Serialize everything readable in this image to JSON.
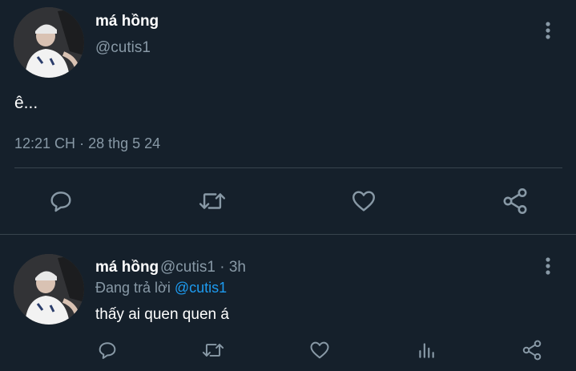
{
  "main_tweet": {
    "display_name": "má hồng",
    "handle": "@cutis1",
    "text": "ê...",
    "time": "12:21 CH",
    "separator": "·",
    "date": "28 thg 5 24",
    "actions": [
      "reply-icon",
      "retweet-icon",
      "like-icon",
      "share-icon"
    ]
  },
  "reply_tweet": {
    "display_name": "má hồng",
    "handle": "@cutis1",
    "separator": "·",
    "age": "3h",
    "replying_label": "Đang trả lời",
    "replying_to": "@cutis1",
    "text": "thấy ai quen quen á",
    "actions": [
      "reply-icon",
      "retweet-icon",
      "like-icon",
      "analytics-icon",
      "share-icon"
    ]
  },
  "colors": {
    "background": "#15202b",
    "primary_text": "#ffffff",
    "secondary_text": "#8899a6",
    "accent": "#1d9bf0",
    "divider": "#38444d"
  }
}
